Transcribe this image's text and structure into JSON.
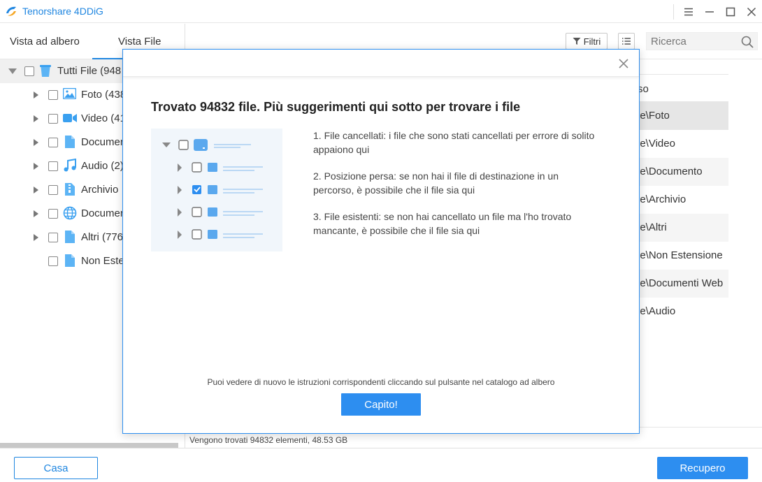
{
  "app": {
    "title": "Tenorshare 4DDiG"
  },
  "window_controls": [
    "menu-icon",
    "minimize-icon",
    "maximize-icon",
    "close-icon"
  ],
  "left_panel": {
    "tabs": [
      {
        "label": "Vista ad albero",
        "active": false
      },
      {
        "label": "Vista File",
        "active": true
      }
    ],
    "tree": {
      "root": {
        "label": "Tutti File (948"
      },
      "items": [
        {
          "label": "Foto (438",
          "icon": "image-icon",
          "expandable": true
        },
        {
          "label": "Video (41",
          "icon": "video-icon",
          "expandable": true
        },
        {
          "label": "Documen",
          "icon": "document-icon",
          "expandable": true
        },
        {
          "label": "Audio (2)",
          "icon": "audio-icon",
          "expandable": true
        },
        {
          "label": "Archivio",
          "icon": "archive-icon",
          "expandable": true
        },
        {
          "label": "Documen",
          "icon": "globe-icon",
          "expandable": true
        },
        {
          "label": "Altri (776",
          "icon": "file-icon",
          "expandable": true
        },
        {
          "label": "Non Este",
          "icon": "file-icon",
          "expandable": false
        }
      ]
    }
  },
  "toolbar": {
    "filter_label": "Filtri",
    "search_placeholder": "Ricerca"
  },
  "file_list": {
    "header_path": "so",
    "rows": [
      {
        "path": "le\\Foto",
        "selected": true
      },
      {
        "path": "le\\Video"
      },
      {
        "path": "le\\Documento"
      },
      {
        "path": "le\\Archivio"
      },
      {
        "path": "le\\Altri"
      },
      {
        "path": "le\\Non Estensione"
      },
      {
        "path": "le\\Documenti Web"
      },
      {
        "path": "le\\Audio"
      }
    ],
    "status": "Vengono trovati 94832 elementi, 48.53 GB"
  },
  "bottom_bar": {
    "home_label": "Casa",
    "recover_label": "Recupero"
  },
  "modal": {
    "title": "Trovato 94832 file. Più suggerimenti qui sotto per trovare i file",
    "tips": [
      "1. File cancellati: i file che sono stati cancellati per errore di solito appaiono qui",
      "2. Posizione persa: se non hai il file di destinazione in un percorso, è possibile che il file sia qui",
      "3. File esistenti: se non hai cancellato un file ma l'ho trovato mancante, è possibile che il file sia qui"
    ],
    "note": "Puoi vedere di nuovo le istruzioni corrispondenti cliccando sul pulsante nel catalogo ad albero",
    "ok_label": "Capito!"
  },
  "colors": {
    "accent": "#2d8ef0",
    "brand": "#1f86e0"
  }
}
